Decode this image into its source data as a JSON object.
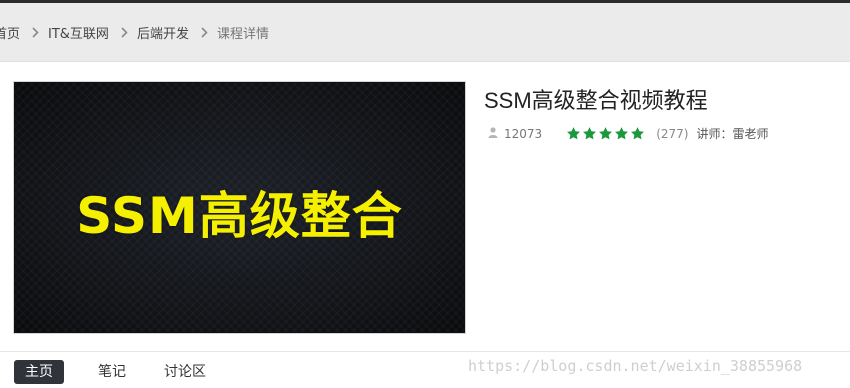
{
  "breadcrumb": {
    "items": [
      "首页",
      "IT&互联网",
      "后端开发",
      "课程详情"
    ]
  },
  "cover": {
    "text": "SSM高级整合"
  },
  "course": {
    "title": "SSM高级整合视频教程",
    "learners": "12073",
    "rating_stars": 5,
    "rating_count": "(277)",
    "teacher_label": "讲师：",
    "teacher_name": "雷老师"
  },
  "tabs": [
    {
      "label": "主页",
      "active": true
    },
    {
      "label": "笔记",
      "active": false
    },
    {
      "label": "讨论区",
      "active": false
    }
  ],
  "watermark": "https://blog.csdn.net/weixin_38855968",
  "colors": {
    "star": "#1a9a3c",
    "cover_text": "#f5ef00",
    "active_tab_bg": "#30343a"
  },
  "icons": {
    "user": "user-icon",
    "separator": "chevron-right-icon",
    "star": "star-icon"
  }
}
